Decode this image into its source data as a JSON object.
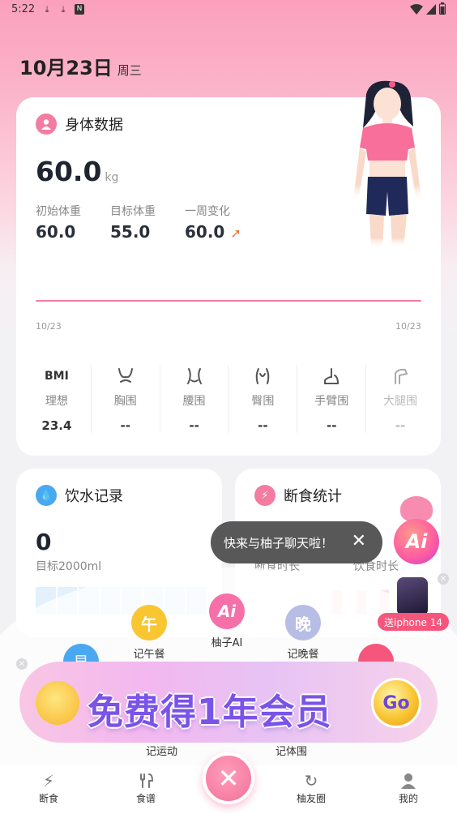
{
  "status": {
    "time": "5:22"
  },
  "header": {
    "date": "10月23日",
    "weekday": "周三"
  },
  "body_card": {
    "title": "身体数据",
    "weight": "60.0",
    "unit": "kg",
    "stats": [
      {
        "label": "初始体重",
        "value": "60.0"
      },
      {
        "label": "目标体重",
        "value": "55.0"
      },
      {
        "label": "一周变化",
        "value": "60.0"
      }
    ],
    "chart": {
      "x_start": "10/23",
      "x_end": "10/23"
    },
    "metrics": [
      {
        "icon": "BMI",
        "label": "理想",
        "value": "23.4"
      },
      {
        "icon": "chest-icon",
        "label": "胸围",
        "value": "--"
      },
      {
        "icon": "waist-icon",
        "label": "腰围",
        "value": "--"
      },
      {
        "icon": "hip-icon",
        "label": "臀围",
        "value": "--"
      },
      {
        "icon": "arm-icon",
        "label": "手臂围",
        "value": "--"
      },
      {
        "icon": "thigh-icon",
        "label": "大腿围",
        "value": "--"
      }
    ]
  },
  "water_card": {
    "title": "饮水记录",
    "value": "0",
    "goal": "目标2000ml"
  },
  "fast_card": {
    "title": "断食统计",
    "label_fast": "断食时长",
    "label_eat": "饮食时长"
  },
  "tooltip": {
    "text": "快来与柚子聊天啦！"
  },
  "ai_button": {
    "label": "Ai"
  },
  "promo": {
    "label": "送iphone 14"
  },
  "quick_actions": [
    {
      "icon_char": "午",
      "label": "记午餐",
      "color": "#f9c531"
    },
    {
      "icon_char": "Ai",
      "label": "柚子AI",
      "color": "#f76fa8"
    },
    {
      "icon_char": "晚",
      "label": "记晚餐",
      "color": "#b8bde6"
    },
    {
      "label": "记运动"
    },
    {
      "label": "记体围"
    }
  ],
  "banner": {
    "text": "免费得1年会员",
    "go": "Go"
  },
  "tabs": [
    {
      "icon": "bolt-icon",
      "label": "断食"
    },
    {
      "icon": "fork-knife-icon",
      "label": "食谱"
    },
    {
      "icon": "refresh-icon",
      "label": "柚友圈"
    },
    {
      "icon": "person-icon",
      "label": "我的"
    }
  ],
  "colors": {
    "accent": "#f36f97",
    "water": "#4aa8f0"
  }
}
